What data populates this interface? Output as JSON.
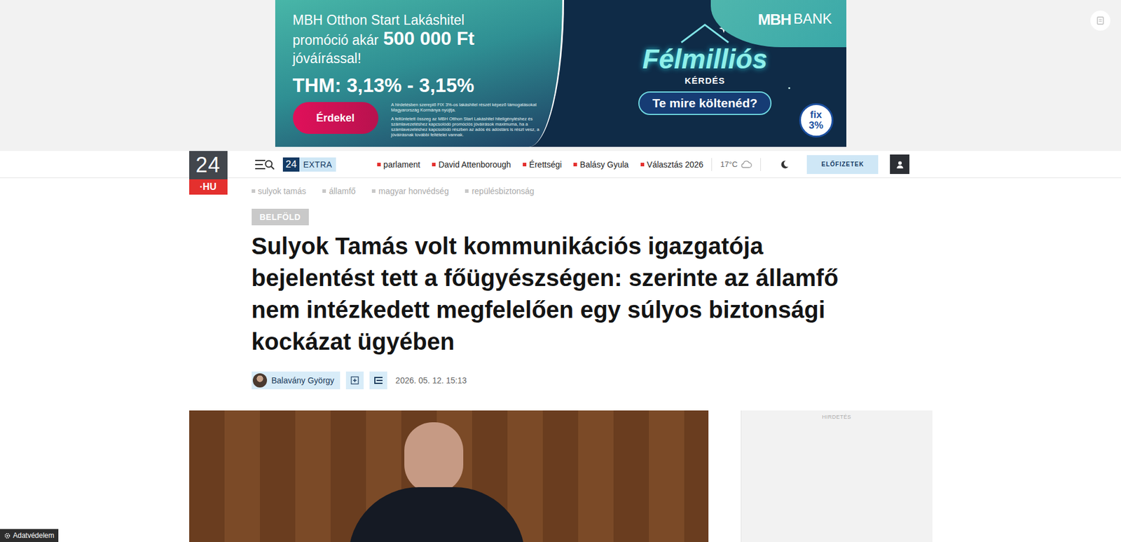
{
  "ad": {
    "headline": "MBH Otthon Start Lakáshitel",
    "promo_prefix": "promóció akár",
    "promo_amount": "500 000 Ft",
    "promo_suffix": "jóváírással!",
    "thm": "THM: 3,13% - 3,15%",
    "cta": "Érdekel",
    "disclaimers": [
      "A hirdetésben szereplő FIX 3%-os lakáshitel részét képező támogatásokat Magyarország Kormánya nyújtja.",
      "A feltüntetett összeg az MBH Otthon Start Lakáshitel hiteligényléshez és számlavezetéshez kapcsolódó promóciós jóváírások maximuma, ha a számlavezetéshez kapcsolódó részben az adós és adóstárs is részt vesz, a jóváírásnak további feltételei vannak."
    ],
    "bank_logo": "MBH",
    "bank_word": "BANK",
    "campaign_title": "Félmilliós",
    "campaign_sub": "KÉRDÉS",
    "campaign_question": "Te mire költenéd?",
    "badge_top": "fix",
    "badge_bottom": "3%"
  },
  "nav": {
    "logo_top": "24",
    "logo_bottom": "·HU",
    "extra_number": "24",
    "extra_word": "EXTRA",
    "links": [
      "parlament",
      "David Attenborough",
      "Érettségi",
      "Balásy Gyula",
      "Választás 2026"
    ],
    "weather": "17°C",
    "subscribe": "ELŐFIZETEK"
  },
  "tags": [
    "sulyok tamás",
    "államfő",
    "magyar honvédség",
    "repülésbiztonság"
  ],
  "article": {
    "category": "BELFÖLD",
    "title": "Sulyok Tamás volt kommunikációs igazgatója bejelentést tett a főügyészségen: szerinte az államfő nem intézkedett megfelelően egy súlyos biztonsági kockázat ügyében",
    "author": "Balavány György",
    "date": "2026. 05. 12. 15:13"
  },
  "sidebar_ad": {
    "label": "HIRDETÉS"
  },
  "privacy_button": "Adatvédelem"
}
